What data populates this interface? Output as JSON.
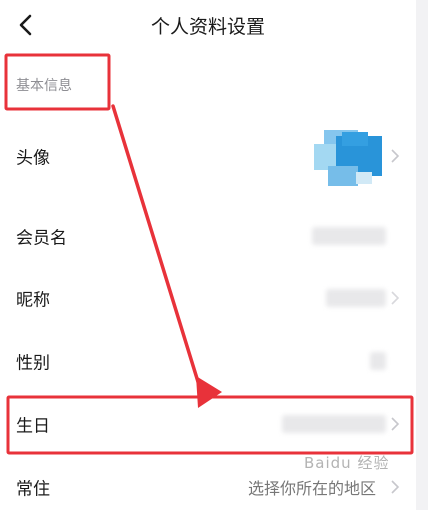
{
  "header": {
    "title": "个人资料设置",
    "back_icon": "chevron-left-icon"
  },
  "section": {
    "label": "基本信息"
  },
  "rows": [
    {
      "label": "头像",
      "value": ""
    },
    {
      "label": "会员名",
      "value": ""
    },
    {
      "label": "昵称",
      "value": ""
    },
    {
      "label": "性别",
      "value": ""
    },
    {
      "label": "生日",
      "value": ""
    },
    {
      "label": "常住",
      "value": "选择你所在的地区"
    }
  ],
  "watermark": {
    "text": "Baidu 经验"
  },
  "colors": {
    "annotation_red": "#e8323a",
    "avatar_blue": "#1e8fd8",
    "secondary_text": "#8e8e93"
  }
}
